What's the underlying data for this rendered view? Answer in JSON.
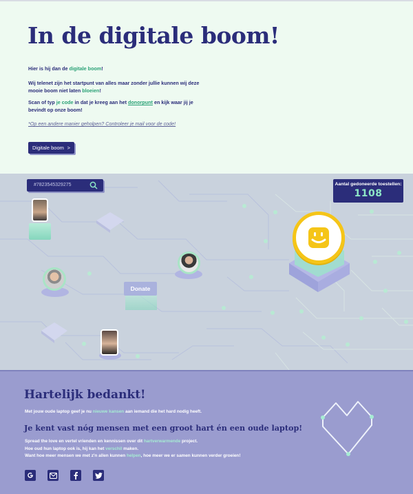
{
  "hero": {
    "title": "In de  digitale boom!",
    "line1_pre": "Hier is hij dan de ",
    "line1_link": "digitale boom",
    "line1_post": "!",
    "line2_pre": "Wij telenet zijn het startpunt van alles maar zonder jullie kunnen wij deze mooie boom niet laten ",
    "line2_link": "bloeien",
    "line2_post": "!",
    "line3_pre": "Scan of typ ",
    "line3_link1": "je code",
    "line3_mid": " in dat je kreeg aan het ",
    "line3_link2": "donorpunt",
    "line3_post": " en kijk waar jij je bevindt op onze boom!",
    "note": "*Op een andere manier geholpen? Controleer je mail voor de code!",
    "button_label": "Digitale boom",
    "button_arrow": ">"
  },
  "board": {
    "search_value": "#7823545329275",
    "counter_label": "Aantal gedoneerde toestellen:",
    "counter_value": "1108",
    "donate_label": "Donate",
    "colors": {
      "accent": "#2b2d7a",
      "green": "#8de6c6",
      "logo": "#f5c518"
    }
  },
  "thanks": {
    "title": "Hartelijk bedankt!",
    "p1_pre": "Met jouw oude laptop geef je nu ",
    "p1_link": "nieuwe kansen",
    "p1_post": " aan iemand die het hard nodig heeft.",
    "subtitle": "Je kent vast nóg mensen met een groot hart én een oude laptop!",
    "p2_pre": "Spread the love en vertel vrienden en kennissen over dit ",
    "p2_link": "hartverwarmende",
    "p2_post": " project.",
    "p3_pre": "Hoe oud hun laptop ook is, hij kan het ",
    "p3_link": "verschil",
    "p3_post": " maken.",
    "p4_pre": "Want hoe meer mensen we met z'n allen kunnen ",
    "p4_link": "helpen",
    "p4_post": ", hoe meer we er samen kunnen verder groeien!",
    "social": [
      "google-icon",
      "mail-icon",
      "facebook-icon",
      "twitter-icon"
    ]
  }
}
